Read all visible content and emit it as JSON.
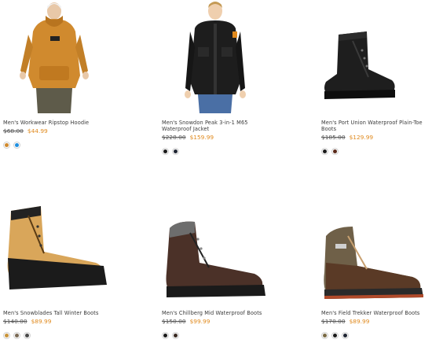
{
  "products": [
    {
      "name": "Men's Workwear Ripstop Hoodie",
      "original_price": "$68.00",
      "sale_price": "$44.99",
      "image": "hoodie-image",
      "swatches": [
        "#d08a2e",
        "#1f8fe0"
      ]
    },
    {
      "name": "Men's Snowdon Peak 3-in-1 M65 Waterproof Jacket",
      "original_price": "$228.00",
      "sale_price": "$159.99",
      "image": "jacket-image",
      "swatches": [
        "#1b1b1b",
        "#202633"
      ]
    },
    {
      "name": "Men's Port Union Waterproof Plain-Toe Boots",
      "original_price": "$185.00",
      "sale_price": "$129.99",
      "image": "black-boot-image",
      "swatches": [
        "#1b1b1b",
        "#5a2a1a"
      ]
    },
    {
      "name": "Men's Snowblades Tall Winter Boots",
      "original_price": "$140.00",
      "sale_price": "$89.99",
      "image": "wheat-winter-boot-image",
      "swatches": [
        "#c8943a",
        "#7a6a55",
        "#4a4a4a"
      ]
    },
    {
      "name": "Men's Chillberg Mid Waterproof Boots",
      "original_price": "$150.00",
      "sale_price": "$99.99",
      "image": "brown-boot-image",
      "swatches": [
        "#1b1b1b",
        "#3a2a22"
      ]
    },
    {
      "name": "Men's Field Trekker Waterproof Boots",
      "original_price": "$170.00",
      "sale_price": "$89.99",
      "image": "field-trekker-boot-image",
      "swatches": [
        "#7a6a44",
        "#1b1b1b",
        "#202633"
      ]
    }
  ],
  "colors": {
    "sale": "#e08a1e",
    "text": "#3a3a3a"
  }
}
